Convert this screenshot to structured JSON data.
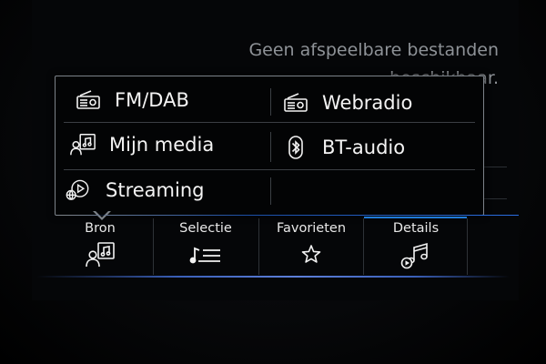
{
  "background": {
    "empty_message": "Geen afspeelbare bestanden beschikbaar."
  },
  "source_menu": {
    "items": [
      {
        "label": "FM/DAB",
        "icon": "radio-icon"
      },
      {
        "label": "Webradio",
        "icon": "webradio-icon"
      },
      {
        "label": "Mijn media",
        "icon": "my-media-icon"
      },
      {
        "label": "BT-audio",
        "icon": "bluetooth-icon"
      },
      {
        "label": "Streaming",
        "icon": "streaming-icon"
      }
    ]
  },
  "tabs": [
    {
      "label": "Bron",
      "icon": "source-media-icon",
      "active": false
    },
    {
      "label": "Selectie",
      "icon": "playlist-icon",
      "active": false
    },
    {
      "label": "Favorieten",
      "icon": "star-icon",
      "active": false
    },
    {
      "label": "Details",
      "icon": "music-play-icon",
      "active": true
    }
  ],
  "colors": {
    "accent": "#1f7bd8",
    "background": "#000000",
    "text": "#f2f2f2",
    "muted_text": "#8e9297",
    "popup_border": "#7d838a"
  }
}
